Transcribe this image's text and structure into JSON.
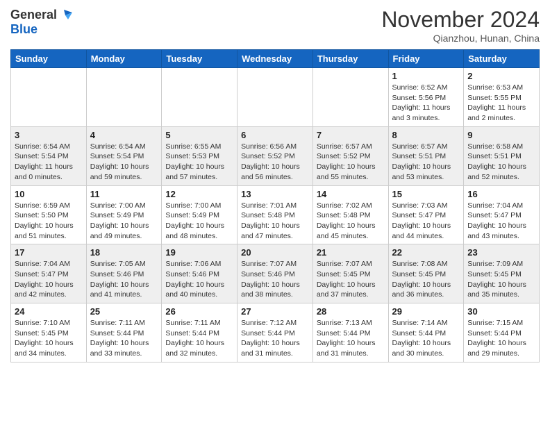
{
  "header": {
    "logo_line1": "General",
    "logo_line2": "Blue",
    "month": "November 2024",
    "location": "Qianzhou, Hunan, China"
  },
  "weekdays": [
    "Sunday",
    "Monday",
    "Tuesday",
    "Wednesday",
    "Thursday",
    "Friday",
    "Saturday"
  ],
  "weeks": [
    [
      {
        "day": "",
        "info": ""
      },
      {
        "day": "",
        "info": ""
      },
      {
        "day": "",
        "info": ""
      },
      {
        "day": "",
        "info": ""
      },
      {
        "day": "",
        "info": ""
      },
      {
        "day": "1",
        "info": "Sunrise: 6:52 AM\nSunset: 5:56 PM\nDaylight: 11 hours\nand 3 minutes."
      },
      {
        "day": "2",
        "info": "Sunrise: 6:53 AM\nSunset: 5:55 PM\nDaylight: 11 hours\nand 2 minutes."
      }
    ],
    [
      {
        "day": "3",
        "info": "Sunrise: 6:54 AM\nSunset: 5:54 PM\nDaylight: 11 hours\nand 0 minutes."
      },
      {
        "day": "4",
        "info": "Sunrise: 6:54 AM\nSunset: 5:54 PM\nDaylight: 10 hours\nand 59 minutes."
      },
      {
        "day": "5",
        "info": "Sunrise: 6:55 AM\nSunset: 5:53 PM\nDaylight: 10 hours\nand 57 minutes."
      },
      {
        "day": "6",
        "info": "Sunrise: 6:56 AM\nSunset: 5:52 PM\nDaylight: 10 hours\nand 56 minutes."
      },
      {
        "day": "7",
        "info": "Sunrise: 6:57 AM\nSunset: 5:52 PM\nDaylight: 10 hours\nand 55 minutes."
      },
      {
        "day": "8",
        "info": "Sunrise: 6:57 AM\nSunset: 5:51 PM\nDaylight: 10 hours\nand 53 minutes."
      },
      {
        "day": "9",
        "info": "Sunrise: 6:58 AM\nSunset: 5:51 PM\nDaylight: 10 hours\nand 52 minutes."
      }
    ],
    [
      {
        "day": "10",
        "info": "Sunrise: 6:59 AM\nSunset: 5:50 PM\nDaylight: 10 hours\nand 51 minutes."
      },
      {
        "day": "11",
        "info": "Sunrise: 7:00 AM\nSunset: 5:49 PM\nDaylight: 10 hours\nand 49 minutes."
      },
      {
        "day": "12",
        "info": "Sunrise: 7:00 AM\nSunset: 5:49 PM\nDaylight: 10 hours\nand 48 minutes."
      },
      {
        "day": "13",
        "info": "Sunrise: 7:01 AM\nSunset: 5:48 PM\nDaylight: 10 hours\nand 47 minutes."
      },
      {
        "day": "14",
        "info": "Sunrise: 7:02 AM\nSunset: 5:48 PM\nDaylight: 10 hours\nand 45 minutes."
      },
      {
        "day": "15",
        "info": "Sunrise: 7:03 AM\nSunset: 5:47 PM\nDaylight: 10 hours\nand 44 minutes."
      },
      {
        "day": "16",
        "info": "Sunrise: 7:04 AM\nSunset: 5:47 PM\nDaylight: 10 hours\nand 43 minutes."
      }
    ],
    [
      {
        "day": "17",
        "info": "Sunrise: 7:04 AM\nSunset: 5:47 PM\nDaylight: 10 hours\nand 42 minutes."
      },
      {
        "day": "18",
        "info": "Sunrise: 7:05 AM\nSunset: 5:46 PM\nDaylight: 10 hours\nand 41 minutes."
      },
      {
        "day": "19",
        "info": "Sunrise: 7:06 AM\nSunset: 5:46 PM\nDaylight: 10 hours\nand 40 minutes."
      },
      {
        "day": "20",
        "info": "Sunrise: 7:07 AM\nSunset: 5:46 PM\nDaylight: 10 hours\nand 38 minutes."
      },
      {
        "day": "21",
        "info": "Sunrise: 7:07 AM\nSunset: 5:45 PM\nDaylight: 10 hours\nand 37 minutes."
      },
      {
        "day": "22",
        "info": "Sunrise: 7:08 AM\nSunset: 5:45 PM\nDaylight: 10 hours\nand 36 minutes."
      },
      {
        "day": "23",
        "info": "Sunrise: 7:09 AM\nSunset: 5:45 PM\nDaylight: 10 hours\nand 35 minutes."
      }
    ],
    [
      {
        "day": "24",
        "info": "Sunrise: 7:10 AM\nSunset: 5:45 PM\nDaylight: 10 hours\nand 34 minutes."
      },
      {
        "day": "25",
        "info": "Sunrise: 7:11 AM\nSunset: 5:44 PM\nDaylight: 10 hours\nand 33 minutes."
      },
      {
        "day": "26",
        "info": "Sunrise: 7:11 AM\nSunset: 5:44 PM\nDaylight: 10 hours\nand 32 minutes."
      },
      {
        "day": "27",
        "info": "Sunrise: 7:12 AM\nSunset: 5:44 PM\nDaylight: 10 hours\nand 31 minutes."
      },
      {
        "day": "28",
        "info": "Sunrise: 7:13 AM\nSunset: 5:44 PM\nDaylight: 10 hours\nand 31 minutes."
      },
      {
        "day": "29",
        "info": "Sunrise: 7:14 AM\nSunset: 5:44 PM\nDaylight: 10 hours\nand 30 minutes."
      },
      {
        "day": "30",
        "info": "Sunrise: 7:15 AM\nSunset: 5:44 PM\nDaylight: 10 hours\nand 29 minutes."
      }
    ]
  ]
}
